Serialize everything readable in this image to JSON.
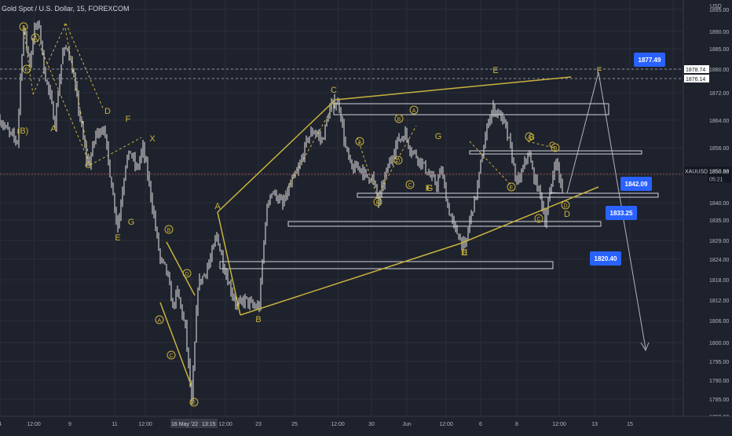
{
  "symbol_title": "Gold Spot / U.S. Dollar, 15, FOREXCOM",
  "currency": "USD",
  "ticker": "XAUUSD",
  "countdown": "05:21",
  "colors": {
    "background": "#1e222d",
    "grid": "#2a2e39",
    "text": "#b2b5be",
    "candle": "#e8e8e8",
    "wave": "#c9b33c",
    "box": "#d1d4dc",
    "label_blue": "#2962ff",
    "price_line": "#9b4b4b"
  },
  "y_axis_labels": [
    "1895.00",
    "1890.00",
    "1885.00",
    "1880.00",
    "1872.00",
    "1864.00",
    "1856.00",
    "1848.00",
    "1840.00",
    "1835.00",
    "1829.00",
    "1824.00",
    "1818.00",
    "1812.00",
    "1806.00",
    "1800.00",
    "1795.00",
    "1790.00",
    "1785.00",
    "1780.00"
  ],
  "x_axis_labels": [
    "4",
    "12:00",
    "9",
    "11",
    "12:00",
    "18",
    "12:00",
    "23",
    "25",
    "12:00",
    "30",
    "Jun",
    "12:00",
    "6",
    "8",
    "12:00",
    "13",
    "15"
  ],
  "x_axis_active": "16 May '22",
  "x_axis_active_time": "13:15",
  "price_tags": {
    "level_1878": "1878.74",
    "level_1876": "1876.14",
    "current": "1850.88"
  },
  "target_labels": [
    "1877.49",
    "1842.09",
    "1833.25",
    "1820.40"
  ],
  "wave_labels": [
    "(B)",
    "A",
    "C",
    "D",
    "F",
    "E",
    "G",
    "X",
    "A",
    "B",
    "C",
    "D",
    "E",
    "F",
    "G",
    "B",
    "C",
    "D",
    "F",
    "E",
    "F",
    "G"
  ],
  "circled_labels": [
    "3",
    "A",
    "B",
    "A",
    "C",
    "D",
    "E",
    "B",
    "A",
    "B",
    "A",
    "C",
    "D",
    "E",
    "A",
    "B",
    "C",
    "D",
    "E"
  ]
}
